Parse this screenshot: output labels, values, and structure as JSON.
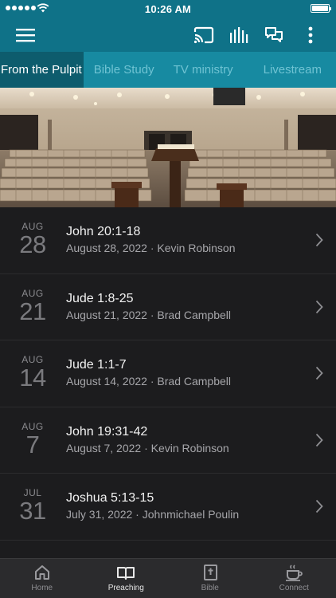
{
  "status_bar": {
    "time": "10:26 AM"
  },
  "app_bar": {
    "icons": [
      "menu-icon",
      "cast-icon",
      "audio-bars-icon",
      "chat-icon",
      "more-vertical-icon"
    ]
  },
  "tabs": [
    {
      "label": "From the Pulpit",
      "active": true
    },
    {
      "label": "Bible Study",
      "active": false
    },
    {
      "label": "TV ministry",
      "active": false
    },
    {
      "label": "Livestream",
      "active": false
    }
  ],
  "sermons": [
    {
      "month": "AUG",
      "day": "28",
      "title": "John 20:1-18",
      "subtitle": "August 28, 2022 · Kevin Robinson"
    },
    {
      "month": "AUG",
      "day": "21",
      "title": "Jude 1:8-25",
      "subtitle": "August 21, 2022 · Brad Campbell"
    },
    {
      "month": "AUG",
      "day": "14",
      "title": "Jude 1:1-7",
      "subtitle": "August 14, 2022 · Brad Campbell"
    },
    {
      "month": "AUG",
      "day": "7",
      "title": "John 19:31-42",
      "subtitle": "August 7, 2022 · Kevin Robinson"
    },
    {
      "month": "JUL",
      "day": "31",
      "title": "Joshua 5:13-15",
      "subtitle": "July 31, 2022 · Johnmichael Poulin"
    }
  ],
  "bottom_nav": [
    {
      "label": "Home",
      "icon": "home-icon",
      "active": false
    },
    {
      "label": "Preaching",
      "icon": "open-book-icon",
      "active": true
    },
    {
      "label": "Bible",
      "icon": "bible-icon",
      "active": false
    },
    {
      "label": "Connect",
      "icon": "coffee-cup-icon",
      "active": false
    }
  ],
  "colors": {
    "primary": "#0f7288",
    "tab_bar": "#178aa1",
    "tab_active": "#0d5c6d",
    "list_bg": "#1c1c1e"
  }
}
